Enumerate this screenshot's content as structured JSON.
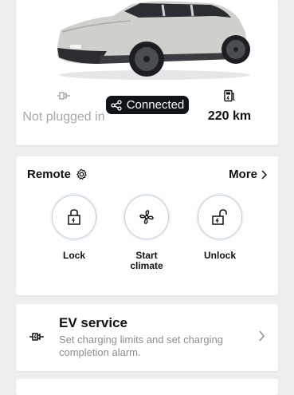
{
  "vehicle": {
    "plug_status": "Not plugged in",
    "connection_status": "Connected",
    "range": "220 km",
    "colors": {
      "pill_bg": "#0f1418",
      "muted": "#a8a8ac"
    }
  },
  "remote": {
    "title": "Remote",
    "more_label": "More",
    "actions": [
      {
        "label": "Lock",
        "icon": "lock-icon"
      },
      {
        "label": "Start\nclimate",
        "icon": "fan-icon"
      },
      {
        "label": "Unlock",
        "icon": "unlock-icon"
      }
    ]
  },
  "ev_service": {
    "title": "EV service",
    "description": "Set charging limits and set charging completion alarm.",
    "icon": "ev-plug-icon"
  }
}
